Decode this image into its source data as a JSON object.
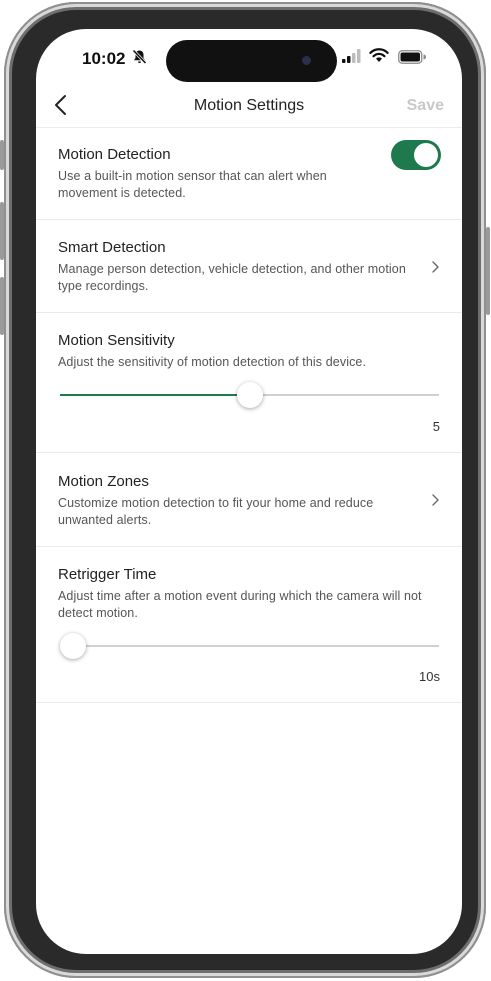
{
  "status_bar": {
    "time": "10:02"
  },
  "nav": {
    "title": "Motion Settings",
    "save_label": "Save"
  },
  "sections": {
    "motion_detection": {
      "title": "Motion Detection",
      "description": "Use a built-in motion sensor that can alert when movement is detected.",
      "toggle_on": true
    },
    "smart_detection": {
      "title": "Smart Detection",
      "description": "Manage person detection, vehicle detection, and other motion type recordings."
    },
    "motion_sensitivity": {
      "title": "Motion Sensitivity",
      "description": "Adjust the sensitivity of motion detection of this device.",
      "value": "5",
      "slider_fraction": 0.5
    },
    "motion_zones": {
      "title": "Motion Zones",
      "description": "Customize motion detection to fit your home and reduce unwanted alerts."
    },
    "retrigger_time": {
      "title": "Retrigger Time",
      "description": "Adjust time after a motion event during which the camera will not detect motion.",
      "value": "10s",
      "slider_fraction": 0.0
    }
  },
  "colors": {
    "accent": "#1e7a4c",
    "save_disabled": "#c8c8c8"
  }
}
